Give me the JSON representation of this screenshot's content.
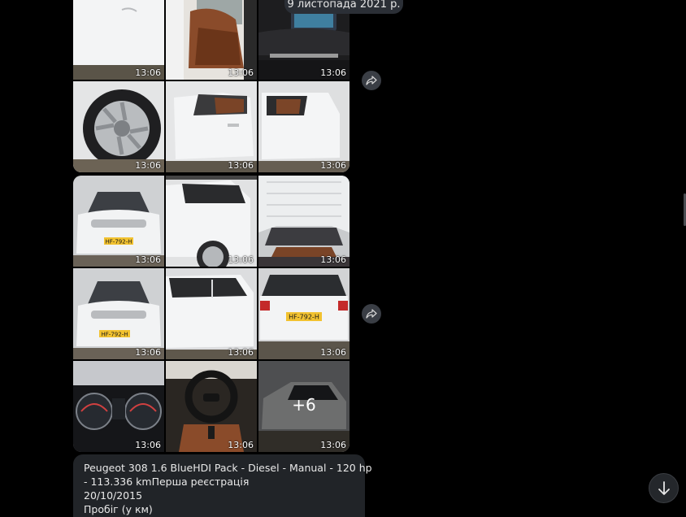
{
  "date_separator": "9 листопада 2021 р.",
  "album1": {
    "photos": [
      {
        "time": "13:06",
        "subject": "car-door-side"
      },
      {
        "time": "13:06",
        "subject": "rear-seats"
      },
      {
        "time": "13:06",
        "subject": "dashboard-screen"
      },
      {
        "time": "13:06",
        "subject": "wheel"
      },
      {
        "time": "13:06",
        "subject": "open-front-door"
      },
      {
        "time": "13:06",
        "subject": "open-rear-door"
      }
    ]
  },
  "album2": {
    "photos": [
      {
        "time": "13:06",
        "subject": "car-front"
      },
      {
        "time": "13:06",
        "subject": "car-side-rear"
      },
      {
        "time": "13:06",
        "subject": "open-tailgate"
      },
      {
        "time": "13:06",
        "subject": "car-front"
      },
      {
        "time": "13:06",
        "subject": "car-side"
      },
      {
        "time": "13:06",
        "subject": "car-rear"
      },
      {
        "time": "13:06",
        "subject": "instrument-cluster"
      },
      {
        "time": "13:06",
        "subject": "steering-wheel"
      },
      {
        "time": "13:06",
        "subject": "car-exterior",
        "more": "+6"
      }
    ]
  },
  "caption": {
    "line1": "Peugeot 308 1.6 BlueHDI Pack - Diesel - Manual - 120 hp",
    "line2": "- 113.336 kmПерша реєстрація",
    "line3": "20/10/2015",
    "line4": "Пробіг (у км)"
  },
  "plates": {
    "front": "HF-792-H",
    "rear": "HF-792-H"
  },
  "icons": {
    "share": "share-arrow-icon",
    "scroll_down": "arrow-down-icon"
  },
  "colors": {
    "background": "#000000",
    "bubble": "#212428",
    "pill": "#2b2f36",
    "car_white": "#eef0f2",
    "leather": "#8a4b2a"
  }
}
